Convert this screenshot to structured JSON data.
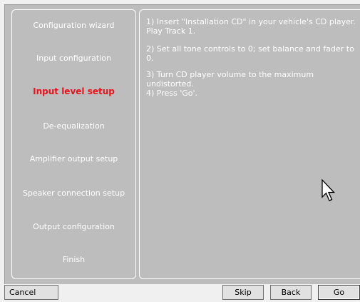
{
  "sidebar": {
    "steps": [
      {
        "label": "Configuration wizard"
      },
      {
        "label": "Input configuration"
      },
      {
        "label": "Input level setup",
        "active": true
      },
      {
        "label": "De-equalization"
      },
      {
        "label": "Amplifier output setup"
      },
      {
        "label": "Speaker connection setup"
      },
      {
        "label": "Output configuration"
      },
      {
        "label": "Finish"
      }
    ],
    "active_color": "#e8121c"
  },
  "content": {
    "instructions": [
      "1) Insert \"Installation CD\" in your vehicle's CD player. Play Track 1.",
      "2) Set all tone controls to 0; set balance and fader to 0.",
      "3) Turn CD player volume to the maximum undistorted.",
      "4) Press 'Go'."
    ]
  },
  "buttons": {
    "cancel": "Cancel",
    "skip": "Skip",
    "back": "Back",
    "go": "Go"
  },
  "cursor": {
    "icon": "arrow-pointer-icon"
  }
}
